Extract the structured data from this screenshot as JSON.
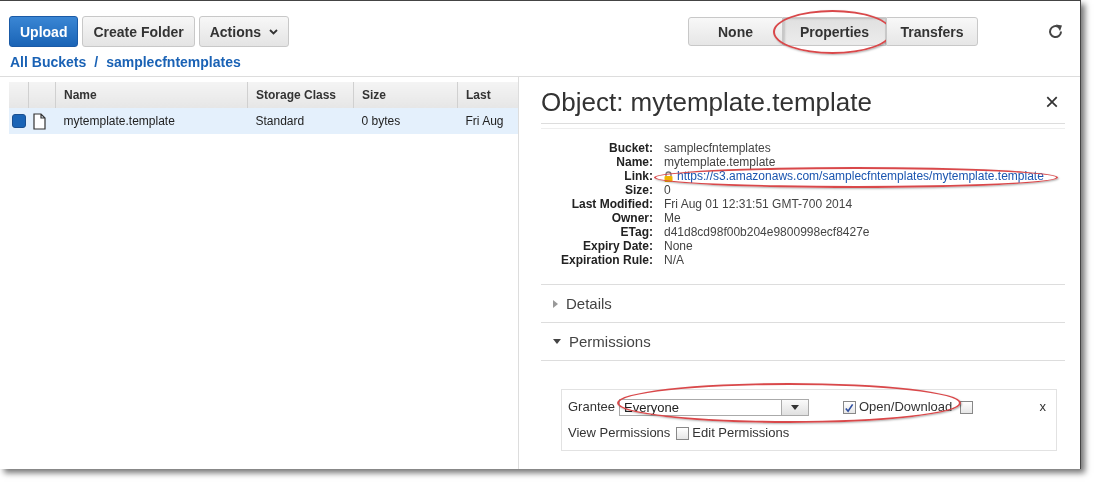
{
  "toolbar": {
    "buttons": [
      {
        "label": "Upload",
        "kind": "primary"
      },
      {
        "label": "Create Folder",
        "kind": "default"
      },
      {
        "label": "Actions",
        "kind": "menu"
      }
    ],
    "view_tabs": [
      {
        "label": "None",
        "selected": false,
        "highlighted": false
      },
      {
        "label": "Properties",
        "selected": true,
        "highlighted": true
      },
      {
        "label": "Transfers",
        "selected": false,
        "highlighted": false
      }
    ]
  },
  "breadcrumb": {
    "items": [
      "All Buckets",
      "samplecfntemplates"
    ],
    "separator": "/"
  },
  "table": {
    "columns": [
      "Name",
      "Storage Class",
      "Size",
      "Last"
    ],
    "rows": [
      {
        "selected": true,
        "cells": [
          "mytemplate.template",
          "Standard",
          "0 bytes",
          "Fri Aug"
        ]
      }
    ]
  },
  "panel": {
    "title": "Object: mytemplate.template",
    "close": "×",
    "properties": [
      {
        "label": "Bucket:",
        "value": "samplecfntemplates",
        "kind": "text",
        "highlighted": false
      },
      {
        "label": "Name:",
        "value": "mytemplate.template",
        "kind": "text",
        "highlighted": false
      },
      {
        "label": "Link:",
        "value": "https://s3.amazonaws.com/samplecfntemplates/mytemplate.template",
        "kind": "link",
        "highlighted": true
      },
      {
        "label": "Size:",
        "value": "0",
        "kind": "text",
        "highlighted": false
      },
      {
        "label": "Last Modified:",
        "value": "Fri Aug 01 12:31:51 GMT-700 2014",
        "kind": "text",
        "highlighted": false
      },
      {
        "label": "Owner:",
        "value": "Me",
        "kind": "text",
        "highlighted": false
      },
      {
        "label": "ETag:",
        "value": "d41d8cd98f00b204e9800998ecf8427e",
        "kind": "text",
        "highlighted": false
      },
      {
        "label": "Expiry Date:",
        "value": "None",
        "kind": "text",
        "highlighted": false
      },
      {
        "label": "Expiration Rule:",
        "value": "N/A",
        "kind": "text",
        "highlighted": false
      }
    ],
    "sections": [
      {
        "label": "Details",
        "expanded": false
      },
      {
        "label": "Permissions",
        "expanded": true
      }
    ],
    "grant": {
      "grantee_label": "Grantee",
      "grantee": "Everyone",
      "highlighted": true,
      "remove": "x",
      "permissions": [
        {
          "label": "Open/Download",
          "checked": true
        },
        {
          "label": "View Permissions",
          "checked": false
        },
        {
          "label": "Edit Permissions",
          "checked": false
        }
      ]
    }
  }
}
